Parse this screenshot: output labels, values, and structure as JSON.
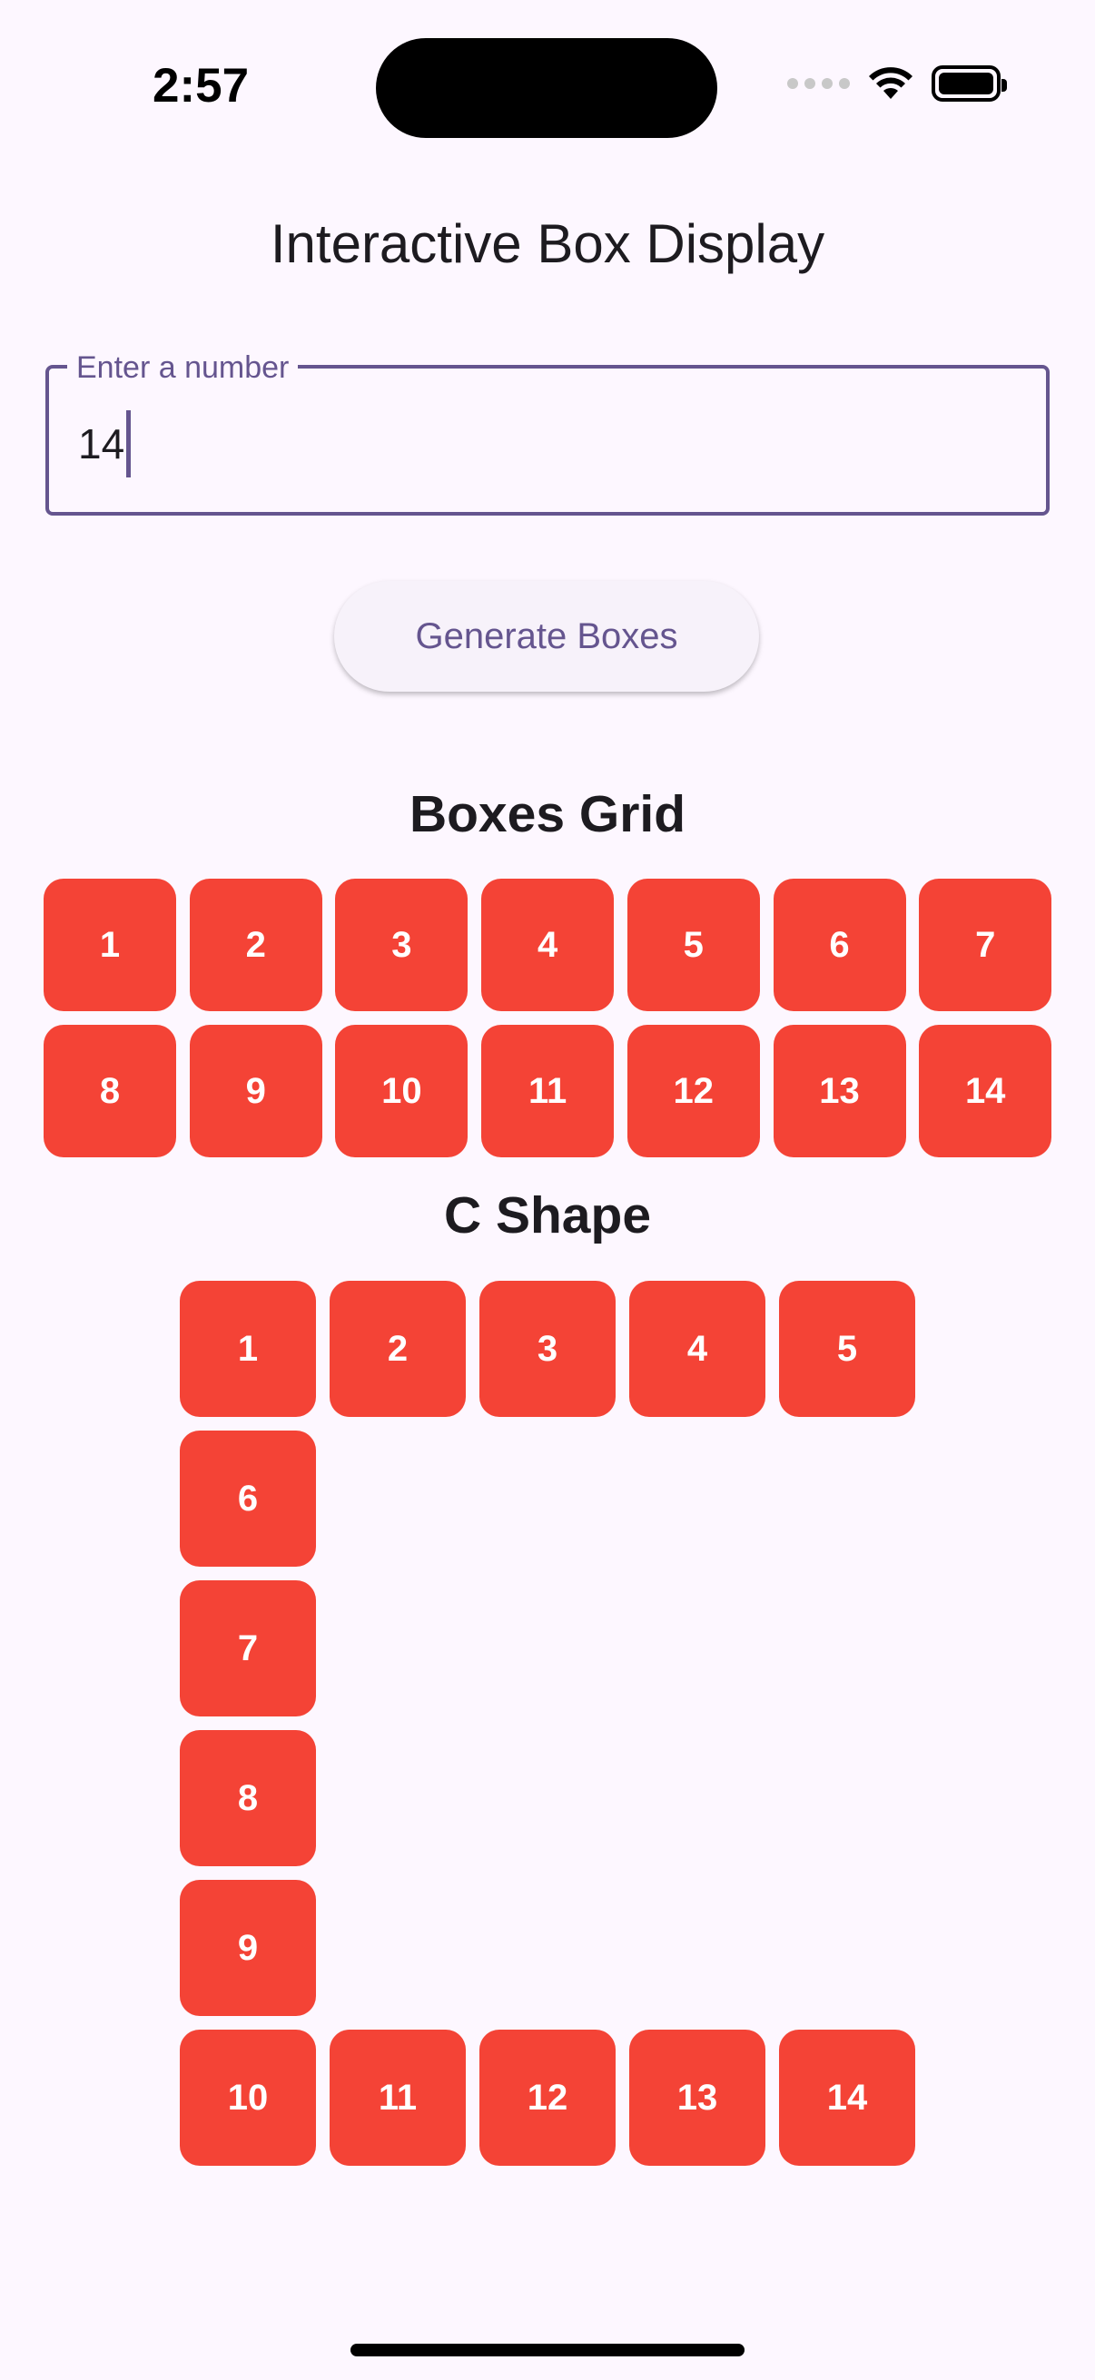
{
  "status_bar": {
    "time": "2:57",
    "icons": [
      "signal-dots-icon",
      "wifi-icon",
      "battery-icon"
    ]
  },
  "app": {
    "title": "Interactive Box Display"
  },
  "input": {
    "label": "Enter a number",
    "value": "14"
  },
  "button": {
    "label": "Generate Boxes"
  },
  "grid": {
    "heading": "Boxes Grid",
    "boxes": [
      "1",
      "2",
      "3",
      "4",
      "5",
      "6",
      "7",
      "8",
      "9",
      "10",
      "11",
      "12",
      "13",
      "14"
    ]
  },
  "c_shape": {
    "heading": "C Shape",
    "boxes": [
      "1",
      "2",
      "3",
      "4",
      "5",
      "6",
      "7",
      "8",
      "9",
      "10",
      "11",
      "12",
      "13",
      "14"
    ]
  },
  "colors": {
    "box": "#f44336",
    "accent": "#65558f",
    "background": "#fdf7ff"
  }
}
